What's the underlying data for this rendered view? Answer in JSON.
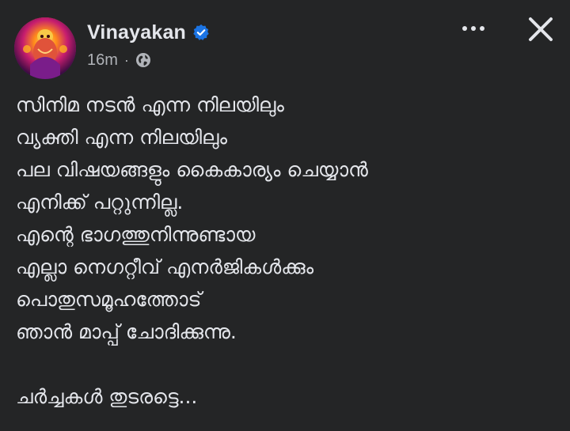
{
  "post": {
    "author": {
      "name": "Vinayakan",
      "verified_icon": "verified-badge-icon",
      "avatar": "profile-avatar"
    },
    "meta": {
      "time": "16m",
      "separator": "·",
      "audience_icon": "globe-icon"
    },
    "actions": {
      "more_icon": "more-horizontal-icon",
      "close_icon": "close-icon"
    },
    "body": {
      "lines": [
        "സിനിമ നടൻ എന്ന നിലയിലും",
        "വ്യക്തി എന്ന നിലയിലും",
        "പല വിഷയങ്ങളും കൈകാര്യം ചെയ്യാൻ",
        "എനിക്ക് പറ്റുന്നില്ല.",
        "എന്റെ ഭാഗത്തുനിന്നുണ്ടായ",
        "എല്ലാ നെഗറ്റീവ് എനർജികൾക്കും",
        "പൊതുസമൂഹത്തോട്",
        "ഞാൻ മാപ്പ് ചോദിക്കുന്നു."
      ],
      "closing": "ചർച്ചകൾ തുടരട്ടെ..."
    },
    "colors": {
      "background": "#242526",
      "text_primary": "#e4e6eb",
      "text_secondary": "#b0b3b8",
      "verified_blue": "#1b74e4"
    }
  }
}
